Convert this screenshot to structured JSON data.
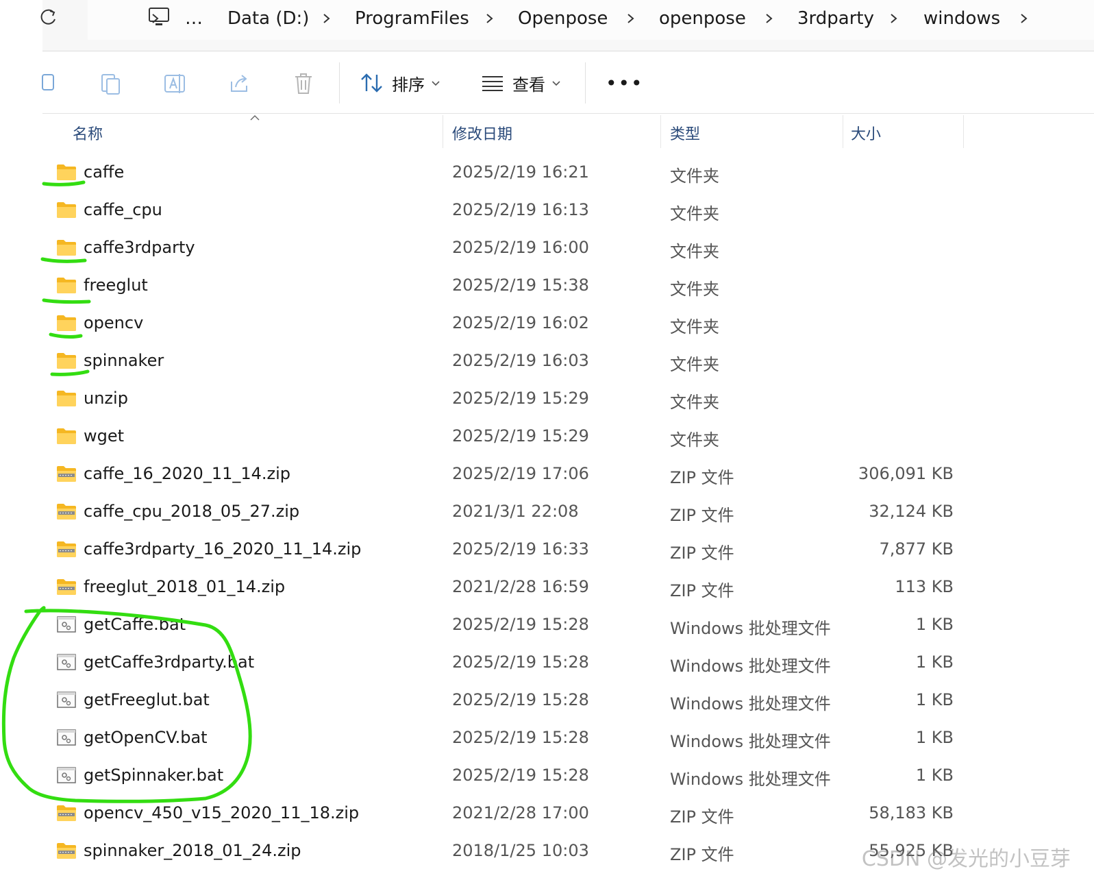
{
  "address_bar": {
    "overflow": "…",
    "crumbs": [
      "Data (D:)",
      "ProgramFiles",
      "Openpose",
      "openpose",
      "3rdparty",
      "windows"
    ]
  },
  "toolbar": {
    "sort_label": "排序",
    "view_label": "查看",
    "more_label": "•••"
  },
  "columns": {
    "name": "名称",
    "date": "修改日期",
    "type": "类型",
    "size": "大小"
  },
  "files": [
    {
      "name": "caffe",
      "date": "2025/2/19 16:21",
      "type": "文件夹",
      "size": "",
      "icon": "folder-icon"
    },
    {
      "name": "caffe_cpu",
      "date": "2025/2/19 16:13",
      "type": "文件夹",
      "size": "",
      "icon": "folder-icon"
    },
    {
      "name": "caffe3rdparty",
      "date": "2025/2/19 16:00",
      "type": "文件夹",
      "size": "",
      "icon": "folder-icon"
    },
    {
      "name": "freeglut",
      "date": "2025/2/19 15:38",
      "type": "文件夹",
      "size": "",
      "icon": "folder-icon"
    },
    {
      "name": "opencv",
      "date": "2025/2/19 16:02",
      "type": "文件夹",
      "size": "",
      "icon": "folder-icon"
    },
    {
      "name": "spinnaker",
      "date": "2025/2/19 16:03",
      "type": "文件夹",
      "size": "",
      "icon": "folder-icon"
    },
    {
      "name": "unzip",
      "date": "2025/2/19 15:29",
      "type": "文件夹",
      "size": "",
      "icon": "folder-icon"
    },
    {
      "name": "wget",
      "date": "2025/2/19 15:29",
      "type": "文件夹",
      "size": "",
      "icon": "folder-icon"
    },
    {
      "name": "caffe_16_2020_11_14.zip",
      "date": "2025/2/19 17:06",
      "type": "ZIP 文件",
      "size": "306,091 KB",
      "icon": "zip-folder-icon"
    },
    {
      "name": "caffe_cpu_2018_05_27.zip",
      "date": "2021/3/1 22:08",
      "type": "ZIP 文件",
      "size": "32,124 KB",
      "icon": "zip-folder-icon"
    },
    {
      "name": "caffe3rdparty_16_2020_11_14.zip",
      "date": "2025/2/19 16:33",
      "type": "ZIP 文件",
      "size": "7,877 KB",
      "icon": "zip-folder-icon"
    },
    {
      "name": "freeglut_2018_01_14.zip",
      "date": "2021/2/28 16:59",
      "type": "ZIP 文件",
      "size": "113 KB",
      "icon": "zip-folder-icon"
    },
    {
      "name": "getCaffe.bat",
      "date": "2025/2/19 15:28",
      "type": "Windows 批处理文件",
      "size": "1 KB",
      "icon": "batch-file-icon"
    },
    {
      "name": "getCaffe3rdparty.bat",
      "date": "2025/2/19 15:28",
      "type": "Windows 批处理文件",
      "size": "1 KB",
      "icon": "batch-file-icon"
    },
    {
      "name": "getFreeglut.bat",
      "date": "2025/2/19 15:28",
      "type": "Windows 批处理文件",
      "size": "1 KB",
      "icon": "batch-file-icon"
    },
    {
      "name": "getOpenCV.bat",
      "date": "2025/2/19 15:28",
      "type": "Windows 批处理文件",
      "size": "1 KB",
      "icon": "batch-file-icon"
    },
    {
      "name": "getSpinnaker.bat",
      "date": "2025/2/19 15:28",
      "type": "Windows 批处理文件",
      "size": "1 KB",
      "icon": "batch-file-icon"
    },
    {
      "name": "opencv_450_v15_2020_11_18.zip",
      "date": "2021/2/28 17:00",
      "type": "ZIP 文件",
      "size": "58,183 KB",
      "icon": "zip-folder-icon"
    },
    {
      "name": "spinnaker_2018_01_24.zip",
      "date": "2018/1/25 10:03",
      "type": "ZIP 文件",
      "size": "55,925 KB",
      "icon": "zip-folder-icon"
    }
  ],
  "annotation_color": "#33dd11",
  "watermark": "CSDN @发光的小豆芽"
}
